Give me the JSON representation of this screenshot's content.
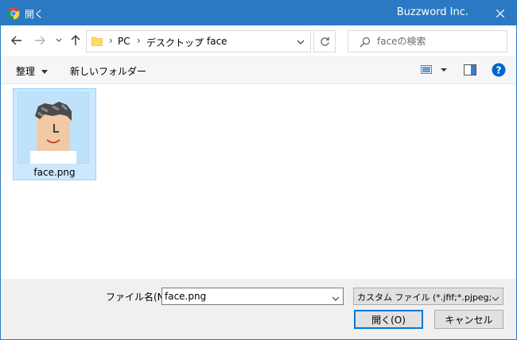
{
  "titlebar": {
    "title": "開く",
    "brand": "Buzzword Inc."
  },
  "nav": {
    "path": [
      "PC",
      "デスクトップ",
      "face"
    ],
    "search_placeholder": "faceの検索"
  },
  "toolbar": {
    "organize_label": "整理",
    "new_folder_label": "新しいフォルダー"
  },
  "files": [
    {
      "name": "face.png",
      "selected": true
    }
  ],
  "footer": {
    "filename_label": "ファイル名(N):",
    "filename_value": "face.png",
    "filetype_value": "カスタム ファイル (*.jfif;*.pjpeg;*.jp",
    "open_label": "開く(O)",
    "cancel_label": "キャンセル"
  },
  "colors": {
    "titlebar": "#2b79c2",
    "selection": "#cce8ff",
    "help": "#0066cc"
  }
}
